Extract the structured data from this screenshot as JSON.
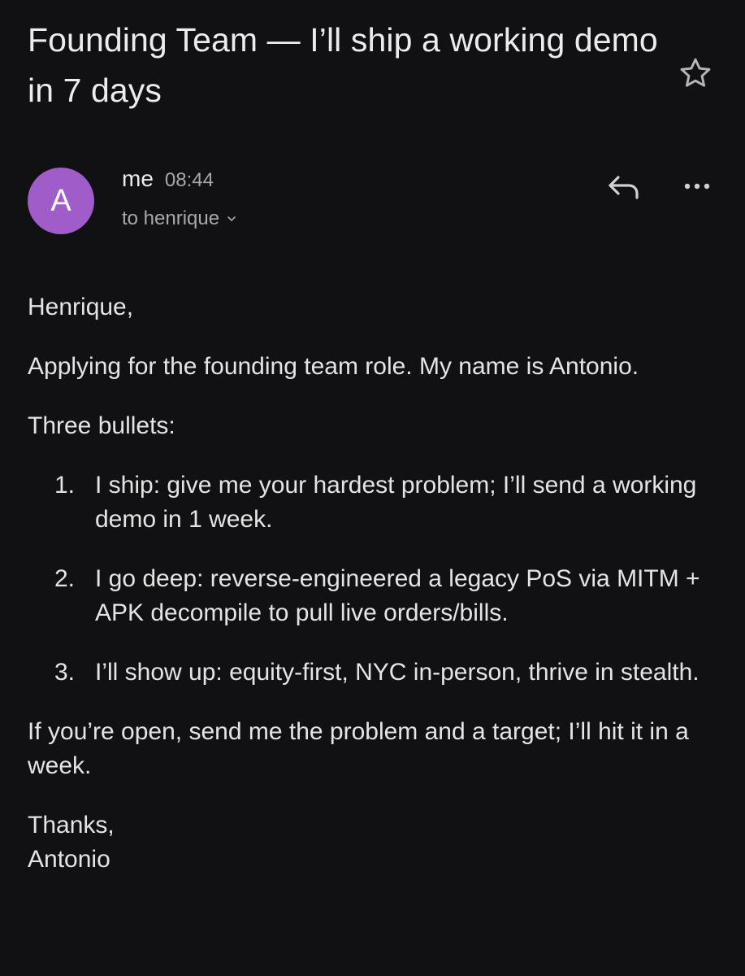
{
  "email": {
    "subject": "Founding Team — I’ll ship a working demo in 7 days",
    "avatar_letter": "A",
    "sender": "me",
    "time": "08:44",
    "recipient": "to henrique",
    "body": {
      "greeting": "Henrique,",
      "intro": "Applying for the founding team role. My name is Antonio.",
      "lead": "Three bullets:",
      "bullets": [
        {
          "number": "1.",
          "text": "I ship: give me your hardest problem; I’ll send a working demo in 1 week."
        },
        {
          "number": "2.",
          "text": "I go deep: reverse-engineered a legacy PoS via MITM + APK decompile to pull live orders/bills."
        },
        {
          "number": "3.",
          "text": "I’ll show up: equity-first, NYC in-person, thrive in stealth."
        }
      ],
      "closing": "If you’re open, send me the problem and a target; I’ll hit it in a week.",
      "signoff": "Thanks,",
      "signature": "Antonio"
    }
  },
  "icons": {
    "star": "star-outline-icon",
    "reply": "reply-icon",
    "more": "more-horizontal-icon",
    "chevron": "chevron-down-icon"
  },
  "colors": {
    "background": "#111113",
    "avatar": "#a05cc9",
    "text_primary": "#ececec",
    "text_secondary": "#a8a8a8"
  }
}
